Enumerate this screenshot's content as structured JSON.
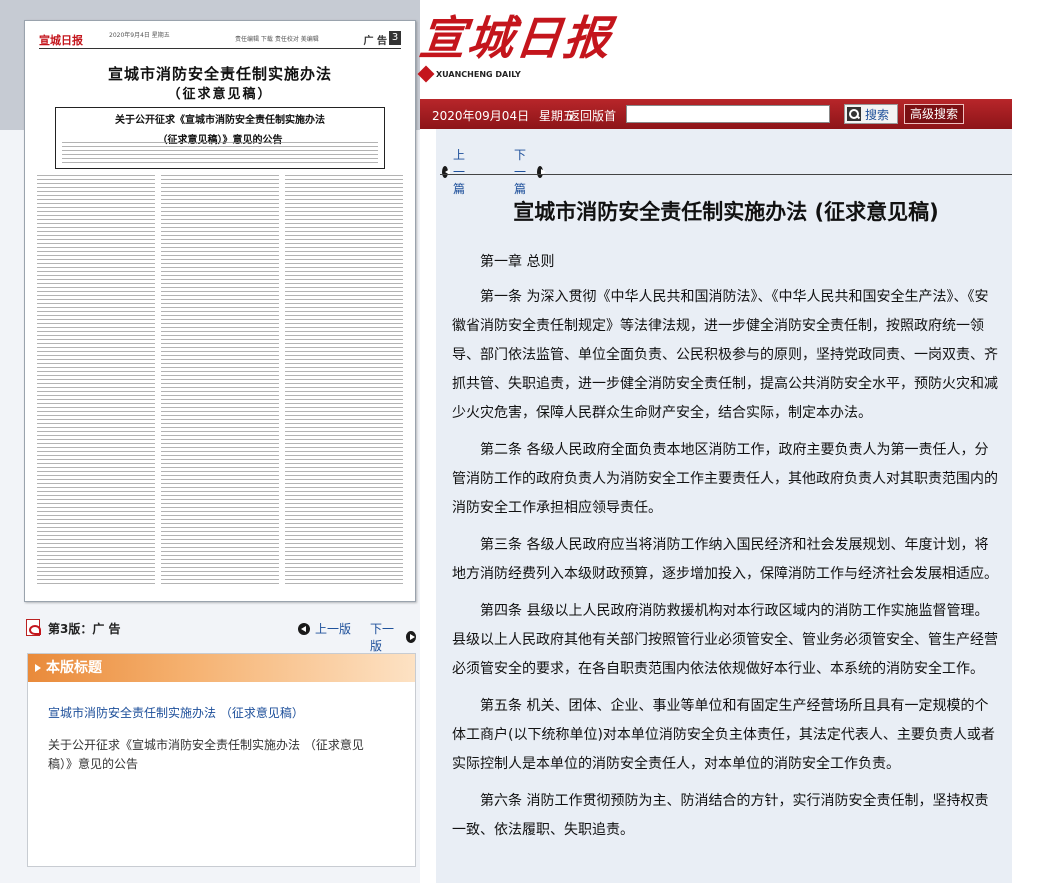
{
  "newspaper": {
    "logo": "宣城日报",
    "logo_sub": "XUANCHENG DAILY"
  },
  "toolbar": {
    "date": "2020年09月04日",
    "weekday": "星期五",
    "back_label": "返回版首",
    "search_value": "",
    "search_label": "搜索",
    "advanced_search_label": "高级搜索"
  },
  "page_thumbnail": {
    "header_date": "2020年9月4日 星期五",
    "header_editor": "责任编辑 下载 责任校对 美编辑",
    "header_section": "广 告",
    "header_number": "3",
    "title": "宣城市消防安全责任制实施办法",
    "subtitle": "（征求意见稿）",
    "notice_title_line1": "关于公开征求《宣城市消防安全责任制实施办法",
    "notice_title_line2": "（征求意见稿）》意见的公告"
  },
  "page_caption": {
    "label": "第3版：广 告",
    "prev_label": "上一版",
    "next_label": "下一版"
  },
  "toc": {
    "header": "本版标题",
    "items": [
      {
        "label": "宣城市消防安全责任制实施办法 （征求意见稿）"
      },
      {
        "label": "关于公开征求《宣城市消防安全责任制实施办法 （征求意见稿）》意见的公告"
      }
    ]
  },
  "article_nav": {
    "prev_label": "上一篇",
    "next_label": "下一篇"
  },
  "article": {
    "title": "宣城市消防安全责任制实施办法 (征求意见稿)",
    "chapter": "第一章  总则",
    "paragraphs": [
      "第一条  为深入贯彻《中华人民共和国消防法》、《中华人民共和国安全生产法》、《安徽省消防安全责任制规定》等法律法规，进一步健全消防安全责任制，按照政府统一领导、部门依法监管、单位全面负责、公民积极参与的原则，坚持党政同责、一岗双责、齐抓共管、失职追责，进一步健全消防安全责任制，提高公共消防安全水平，预防火灾和减少火灾危害，保障人民群众生命财产安全，结合实际，制定本办法。",
      "第二条  各级人民政府全面负责本地区消防工作，政府主要负责人为第一责任人，分管消防工作的政府负责人为消防安全工作主要责任人，其他政府负责人对其职责范围内的消防安全工作承担相应领导责任。",
      "第三条  各级人民政府应当将消防工作纳入国民经济和社会发展规划、年度计划，将地方消防经费列入本级财政预算，逐步增加投入，保障消防工作与经济社会发展相适应。",
      "第四条  县级以上人民政府消防救援机构对本行政区域内的消防工作实施监督管理。县级以上人民政府其他有关部门按照管行业必须管安全、管业务必须管安全、管生产经营必须管安全的要求，在各自职责范围内依法依规做好本行业、本系统的消防安全工作。",
      "第五条  机关、团体、企业、事业等单位和有固定生产经营场所且具有一定规模的个体工商户(以下统称单位)对本单位消防安全负主体责任，其法定代表人、主要负责人或者实际控制人是本单位的消防安全责任人，对本单位的消防安全工作负责。",
      "第六条  消防工作贯彻预防为主、防消结合的方针，实行消防安全责任制，坚持权责一致、依法履职、失职追责。"
    ]
  }
}
